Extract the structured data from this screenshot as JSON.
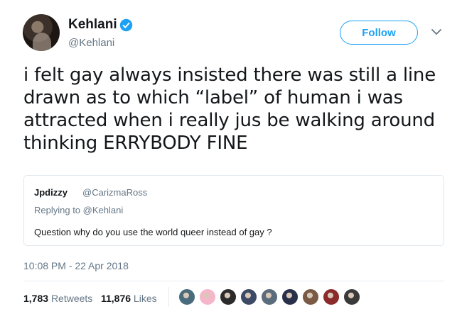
{
  "author": {
    "display_name": "Kehlani",
    "handle": "@Kehlani",
    "verified": true,
    "avatar_icon": "user-avatar-icon"
  },
  "follow_button": {
    "label": "Follow",
    "color": "#1da1f2"
  },
  "tweet": {
    "text": "i felt gay always insisted there was still a line drawn as to which “label” of human i was attracted when i really jus be walking around thinking ERRYBODY FINE"
  },
  "quoted_tweet": {
    "display_name": "Jpdizzy",
    "handle": "@CarizmaRoss",
    "replying_to_prefix": "Replying to",
    "replying_to_handle": "@Kehlani",
    "text": "Question why do you use the world queer instead of gay ?"
  },
  "timestamp": "10:08 PM - 22 Apr 2018",
  "stats": {
    "retweets_count": "1,783",
    "retweets_label": "Retweets",
    "likes_count": "11,876",
    "likes_label": "Likes"
  },
  "likers": [
    {
      "color": "#4a6b7c"
    },
    {
      "color": "#f4b6c8"
    },
    {
      "color": "#2b2b2b"
    },
    {
      "color": "#3c4a66"
    },
    {
      "color": "#5b6c7d"
    },
    {
      "color": "#2a2f4a"
    },
    {
      "color": "#7a5a44"
    },
    {
      "color": "#8a2a2a"
    },
    {
      "color": "#3a3a3a"
    }
  ],
  "colors": {
    "accent": "#1da1f2",
    "secondary_text": "#657786",
    "border": "#e1e8ed"
  }
}
